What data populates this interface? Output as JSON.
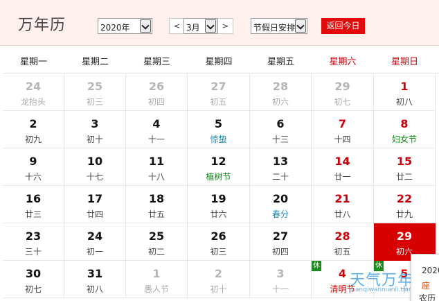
{
  "header": {
    "title": "万年历",
    "year_select": "2020年",
    "prev_label": "<",
    "month_select": "3月",
    "next_label": ">",
    "holiday_select": "节假日安排",
    "today_label": "返回今日"
  },
  "weekdays": [
    "星期一",
    "星期二",
    "星期三",
    "星期四",
    "星期五",
    "星期六",
    "星期日"
  ],
  "weeks": [
    [
      {
        "day": "24",
        "lunar": "龙抬头",
        "other": true
      },
      {
        "day": "25",
        "lunar": "初三",
        "other": true
      },
      {
        "day": "26",
        "lunar": "初四",
        "other": true
      },
      {
        "day": "27",
        "lunar": "初五",
        "other": true
      },
      {
        "day": "28",
        "lunar": "初六",
        "other": true
      },
      {
        "day": "29",
        "lunar": "初七",
        "other": true
      },
      {
        "day": "1",
        "lunar": "初八"
      }
    ],
    [
      {
        "day": "2",
        "lunar": "初九"
      },
      {
        "day": "3",
        "lunar": "初十"
      },
      {
        "day": "4",
        "lunar": "十一"
      },
      {
        "day": "5",
        "lunar": "惊蛰",
        "kind": "term"
      },
      {
        "day": "6",
        "lunar": "十三"
      },
      {
        "day": "7",
        "lunar": "十四"
      },
      {
        "day": "8",
        "lunar": "妇女节",
        "kind": "fest"
      }
    ],
    [
      {
        "day": "9",
        "lunar": "十六"
      },
      {
        "day": "10",
        "lunar": "十七"
      },
      {
        "day": "11",
        "lunar": "十八"
      },
      {
        "day": "12",
        "lunar": "植树节",
        "kind": "fest"
      },
      {
        "day": "13",
        "lunar": "二十"
      },
      {
        "day": "14",
        "lunar": "廿一"
      },
      {
        "day": "15",
        "lunar": "廿二"
      }
    ],
    [
      {
        "day": "16",
        "lunar": "廿三"
      },
      {
        "day": "17",
        "lunar": "廿四"
      },
      {
        "day": "18",
        "lunar": "廿五"
      },
      {
        "day": "19",
        "lunar": "廿六"
      },
      {
        "day": "20",
        "lunar": "春分",
        "kind": "term"
      },
      {
        "day": "21",
        "lunar": "廿八"
      },
      {
        "day": "22",
        "lunar": "廿九"
      }
    ],
    [
      {
        "day": "23",
        "lunar": "三十"
      },
      {
        "day": "24",
        "lunar": "初一"
      },
      {
        "day": "25",
        "lunar": "初二"
      },
      {
        "day": "26",
        "lunar": "初三"
      },
      {
        "day": "27",
        "lunar": "初四"
      },
      {
        "day": "28",
        "lunar": "初五"
      },
      {
        "day": "29",
        "lunar": "初六",
        "selected": true
      }
    ],
    [
      {
        "day": "30",
        "lunar": "初七"
      },
      {
        "day": "31",
        "lunar": "初八"
      },
      {
        "day": "1",
        "lunar": "愚人节",
        "other": true
      },
      {
        "day": "2",
        "lunar": "初十",
        "other": true
      },
      {
        "day": "3",
        "lunar": "十一",
        "other": true
      },
      {
        "day": "4",
        "lunar": "清明节",
        "other": true,
        "red": true,
        "kind": "hol",
        "badge": "休"
      },
      {
        "day": "5",
        "lunar": "十",
        "other": true,
        "red": true,
        "badge": "休"
      }
    ]
  ],
  "popup": {
    "line1": "2020",
    "line2": "座",
    "line3": "农历"
  },
  "watermark": {
    "text": "天气万年历",
    "sub": "tianqiwannianli.tianqi.com"
  },
  "colors": {
    "accent": "#e20b0b",
    "weekend": "#c7000b",
    "solar_term": "#1b8bb5",
    "festival": "#0a8a10",
    "rest_badge": "#1a8a1a"
  }
}
